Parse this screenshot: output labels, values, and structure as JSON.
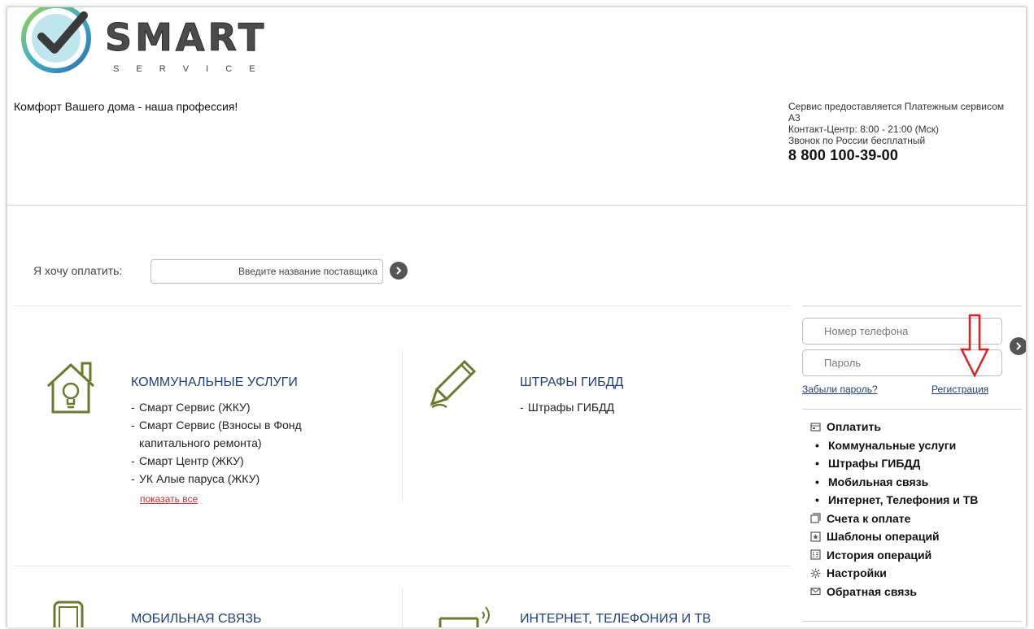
{
  "brand": {
    "logo_word": "SMART",
    "logo_sub": "S E R V I C E",
    "tagline": "Комфорт Вашего дома - наша профессия!"
  },
  "provider": {
    "line1": "Сервис предоставляется Платежным сервисом А3",
    "line2": "Контакт-Центр: 8:00 - 21:00 (Мск)",
    "line3": "Звонок по России бесплатный",
    "phone": "8 800 100-39-00"
  },
  "search": {
    "label": "Я хочу оплатить:",
    "placeholder": "Введите название поставщика"
  },
  "categories": {
    "utilities": {
      "title": "КОММУНАЛЬНЫЕ УСЛУГИ",
      "items": [
        "Смарт Сервис (ЖКУ)",
        "Смарт Сервис (Взносы в Фонд капитального ремонта)",
        "Смарт Центр (ЖКУ)",
        "УК Алые паруса (ЖКУ)"
      ],
      "show_all": "показать все"
    },
    "fines": {
      "title": "ШТРАФЫ ГИБДД",
      "items": [
        "Штрафы ГИБДД"
      ]
    },
    "mobile": {
      "title": "МОБИЛЬНАЯ СВЯЗЬ"
    },
    "internet": {
      "title": "ИНТЕРНЕТ, ТЕЛЕФОНИЯ И ТВ"
    }
  },
  "login": {
    "phone_placeholder": "Номер телефона",
    "password_placeholder": "Пароль",
    "forgot": "Забыли пароль?",
    "register": "Регистрация"
  },
  "menu": {
    "pay": "Оплатить",
    "pay_sub": [
      "Коммунальные услуги",
      "Штрафы ГИБДД",
      "Мобильная связь",
      "Интернет, Телефония и ТВ"
    ],
    "bills": "Счета к оплате",
    "templates": "Шаблоны операций",
    "history": "История операций",
    "settings": "Настройки",
    "feedback": "Обратная связь"
  },
  "colors": {
    "accent_blue": "#1f3f7a",
    "link_red": "#d9262b",
    "icon_olive": "#6b7a2a",
    "arrow_red": "#e02020"
  }
}
